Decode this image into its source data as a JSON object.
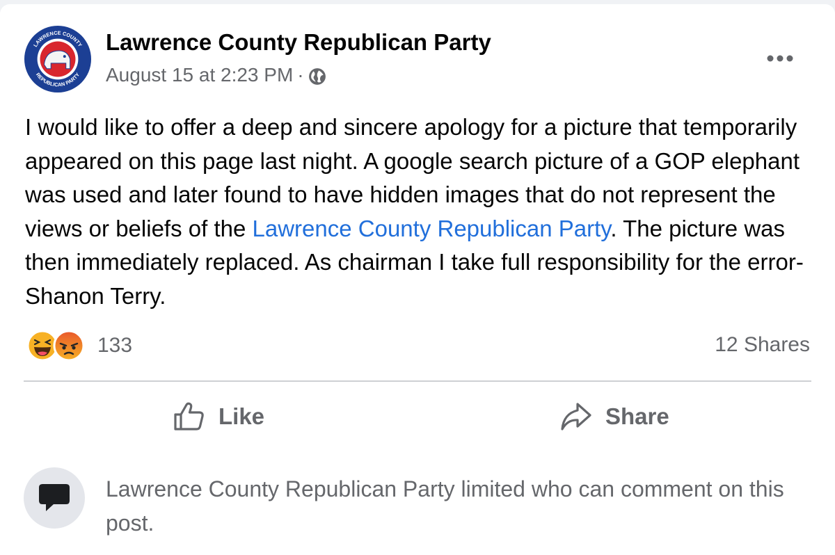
{
  "post": {
    "page_name": "Lawrence County Republican Party",
    "timestamp": "August 15 at 2:23 PM",
    "separator": "·",
    "audience_icon": "globe-icon",
    "more_icon": "more-options-icon",
    "body_part1": "I would like to offer a deep and sincere apology for a picture that temporarily appeared on this page last night. A google search picture of a GOP elephant was used and later found to have hidden images that do not represent the views or beliefs of the ",
    "body_link": "Lawrence County Republican Party",
    "body_part2": ". The picture was then immediately replaced. As chairman I take full responsibility for the error- Shanon Terry."
  },
  "avatar": {
    "ring_text_top": "LAWRENCE COUNTY",
    "ring_text_bottom": "REPUBLICAN PARTY"
  },
  "reactions": {
    "icons": [
      "haha-reaction-icon",
      "angry-reaction-icon"
    ],
    "count": "133",
    "shares": "12 Shares"
  },
  "actions": {
    "like_label": "Like",
    "like_icon": "thumbs-up-icon",
    "share_label": "Share",
    "share_icon": "share-arrow-icon"
  },
  "comments": {
    "icon": "comment-bubble-icon",
    "notice": "Lawrence County Republican Party limited who can comment on this post."
  },
  "colors": {
    "link": "#216fdb",
    "secondary_text": "#65676b",
    "primary_text": "#050505",
    "avatar_blue": "#1c3f94",
    "avatar_red": "#d8262e"
  }
}
